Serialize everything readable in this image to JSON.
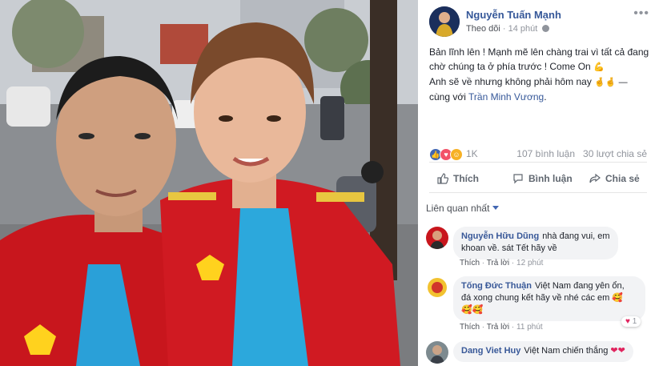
{
  "post": {
    "author": "Nguyễn Tuấn Mạnh",
    "follow_label": "Theo dõi",
    "time": "14 phút",
    "options_label": "•••",
    "text_line1": "Bản lĩnh lên ! Mạnh mẽ lên chàng trai vì tất cả đang",
    "text_line2": "chờ chúng ta ở phía trước ! Come On",
    "text_line3": "Anh sẽ về nhưng không phải hôm nay",
    "text_line4_prefix": "cùng với",
    "tagged": "Trần Minh Vương",
    "emoji_flex": "💪",
    "emoji_hands": "🤞🤞 —"
  },
  "stats": {
    "reaction_count": "1K",
    "comments": "107 bình luận",
    "shares": "30 lượt chia sẻ",
    "reactions": [
      "like",
      "love",
      "haha"
    ]
  },
  "actions": {
    "like": "Thích",
    "comment": "Bình luận",
    "share": "Chia sẻ"
  },
  "sort_label": "Liên quan nhất",
  "comments": [
    {
      "name": "Nguyễn Hữu Dũng",
      "text_a": "nhà đang vui, em",
      "text_b": "khoan về. sát Tết hãy về",
      "like": "Thích",
      "reply": "Trả lời",
      "time": "12 phút"
    },
    {
      "name": "Tống Đức Thuận",
      "text_a": "Việt Nam đang yên ổn,",
      "text_b": "đá xong chung kết hãy về nhé các em",
      "emoji_end": "🥰",
      "emoji_line": "🥰🥰",
      "like": "Thích",
      "reply": "Trả lời",
      "time": "11 phút",
      "reaction_count": "1"
    },
    {
      "name": "Dang Viet Huy",
      "text_a": "Việt Nam chiến thắng",
      "emoji_end": "❤❤"
    }
  ],
  "colors": {
    "link": "#365899",
    "meta": "#90949c",
    "bubble": "#f2f3f5",
    "jacket": "#c8161d"
  }
}
